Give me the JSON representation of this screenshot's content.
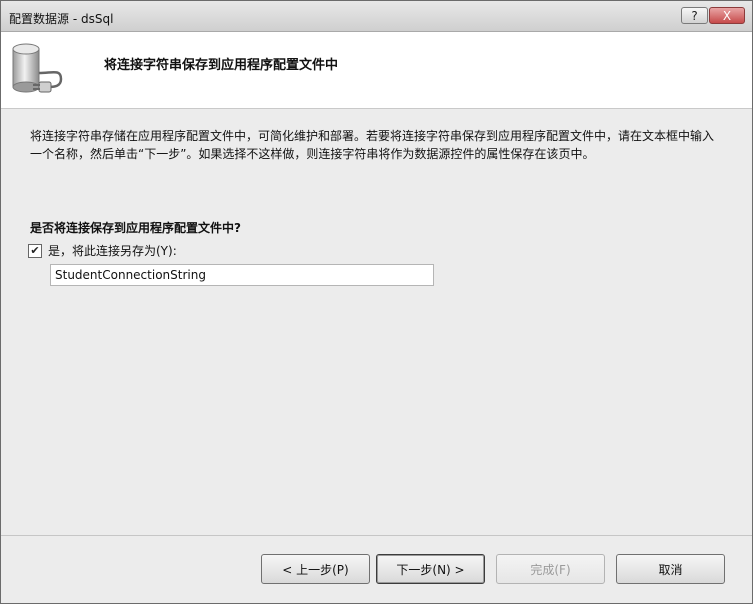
{
  "window": {
    "title": "配置数据源 - dsSql",
    "help_label": "?",
    "close_label": "X"
  },
  "header": {
    "title": "将连接字符串保存到应用程序配置文件中",
    "icon": "database-plug-icon"
  },
  "content": {
    "description": "将连接字符串存储在应用程序配置文件中，可简化维护和部署。若要将连接字符串保存到应用程序配置文件中，请在文本框中输入一个名称，然后单击“下一步”。如果选择不这样做，则连接字符串将作为数据源控件的属性保存在该页中。",
    "question": "是否将连接保存到应用程序配置文件中?",
    "checkbox": {
      "label": "是，将此连接另存为(Y):",
      "checked": true
    },
    "connection_name": {
      "value": "StudentConnectionString"
    }
  },
  "buttons": {
    "previous": "< 上一步(P)",
    "next": "下一步(N) >",
    "finish": "完成(F)",
    "cancel": "取消"
  }
}
